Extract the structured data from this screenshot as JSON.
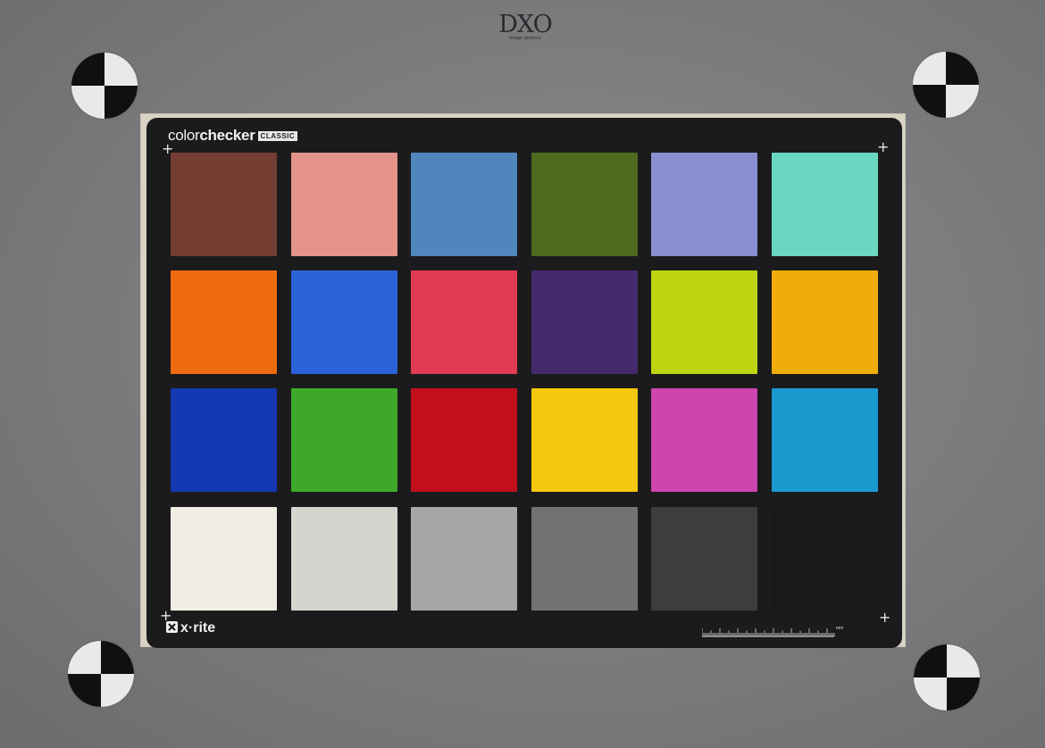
{
  "logo": {
    "main": "DXO",
    "sub": "Image Science"
  },
  "chart": {
    "brand_light": "color",
    "brand_bold": "checker",
    "brand_tag": "CLASSIC",
    "maker": "x·rite",
    "scale_unit": "mm",
    "patches": [
      [
        "#733d31",
        "#e4938b",
        "#4f86bd",
        "#4e6a1f",
        "#8890cf",
        "#6ad7c2"
      ],
      [
        "#ee6b0f",
        "#2d63d9",
        "#e33a55",
        "#462a6e",
        "#bfd411",
        "#f0ad09"
      ],
      [
        "#1437b2",
        "#3ea82a",
        "#c30e1d",
        "#f5c70d",
        "#cd45ad",
        "#199bd0"
      ],
      [
        "#f1ede2",
        "#d5d4cf",
        "#a6a6a5",
        "#737273",
        "#3c3d3f",
        "#19191a"
      ]
    ]
  },
  "colors": {
    "background": "#7e7e80",
    "card": "#1b1b1d",
    "card_border": "#d8d3c4"
  }
}
